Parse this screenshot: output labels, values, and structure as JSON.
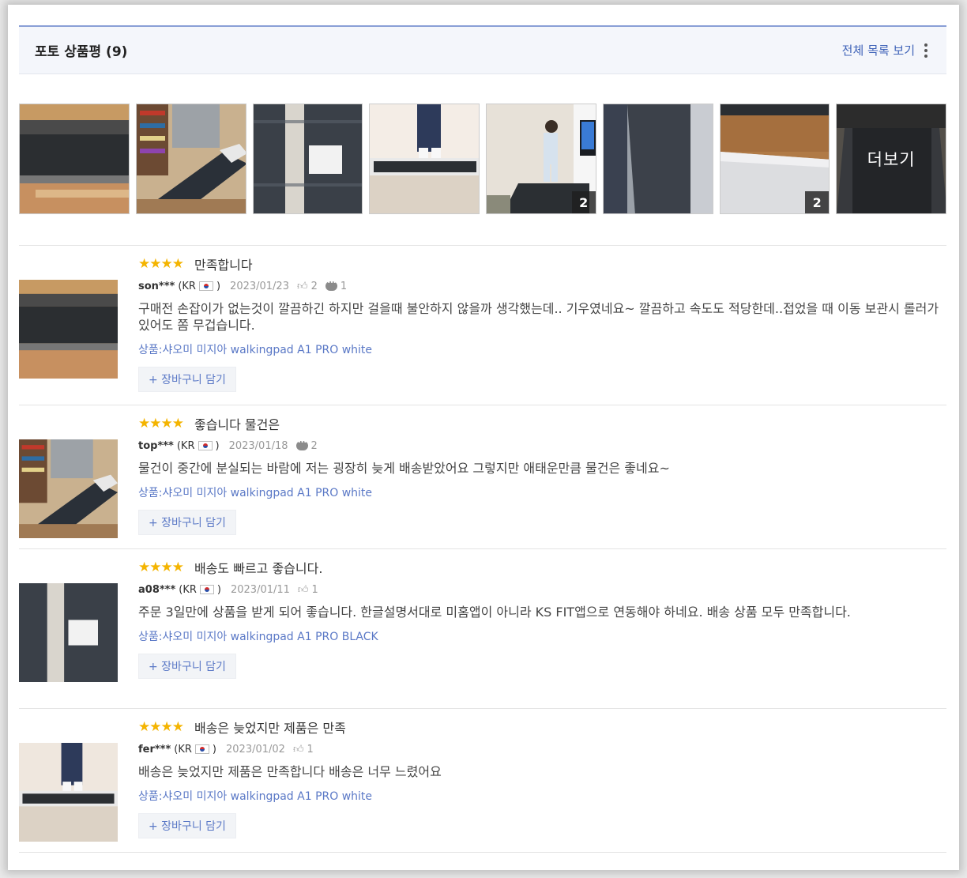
{
  "header": {
    "title": "포토 상품평",
    "count": "(9)",
    "view_all": "전체 목록 보기"
  },
  "gallery": [
    {
      "badge": ""
    },
    {
      "badge": ""
    },
    {
      "badge": ""
    },
    {
      "badge": ""
    },
    {
      "badge": "2"
    },
    {
      "badge": ""
    },
    {
      "badge": "2"
    },
    {
      "more": "더보기"
    }
  ],
  "reviews": [
    {
      "stars": "★★★★",
      "rating": 4,
      "headline": "만족합니다",
      "user": "son***",
      "country_open": "(KR",
      "country_close": ")",
      "date": "2023/01/23",
      "likes": "2",
      "comments": "1",
      "text": "구매전 손잡이가 없는것이 깔끔하긴 하지만 걸을때 불안하지 않을까 생각했는데.. 기우였네요~ 깔끔하고 속도도 적당한데..접었을 때 이동 보관시 롤러가 있어도 쫌 무겁습니다.",
      "product": "상품:샤오미 미지아 walkingpad A1 PRO white",
      "cart": "+ 장바구니 담기"
    },
    {
      "stars": "★★★★",
      "rating": 4,
      "headline": "좋습니다 물건은",
      "user": "top***",
      "country_open": "(KR",
      "country_close": ")",
      "date": "2023/01/18",
      "comments": "2",
      "text": "물건이 중간에 분실되는 바람에 저는 굉장히 늦게 배송받았어요 그렇지만 애태운만큼 물건은 좋네요~",
      "product": "상품:샤오미 미지아 walkingpad A1 PRO white",
      "cart": "+ 장바구니 담기"
    },
    {
      "stars": "★★★★",
      "rating": 4,
      "headline": "배송도 빠르고 좋습니다.",
      "user": "a08***",
      "country_open": "(KR",
      "country_close": ")",
      "date": "2023/01/11",
      "likes": "1",
      "text": "주문 3일만에 상품을 받게 되어 좋습니다. 한글설명서대로 미홈앱이 아니라 KS FIT앱으로 연동해야 하네요. 배송 상품 모두 만족합니다.",
      "product": "상품:샤오미 미지아 walkingpad A1 PRO BLACK",
      "cart": "+ 장바구니 담기"
    },
    {
      "stars": "★★★★",
      "rating": 4,
      "headline": "배송은 늦었지만 제품은 만족",
      "user": "fer***",
      "country_open": "(KR",
      "country_close": ")",
      "date": "2023/01/02",
      "likes": "1",
      "text": "배송은 늦었지만 제품은 만족합니다 배송은 너무 느렸어요",
      "product": "상품:샤오미 미지아 walkingpad A1 PRO white",
      "cart": "+ 장바구니 담기"
    }
  ]
}
